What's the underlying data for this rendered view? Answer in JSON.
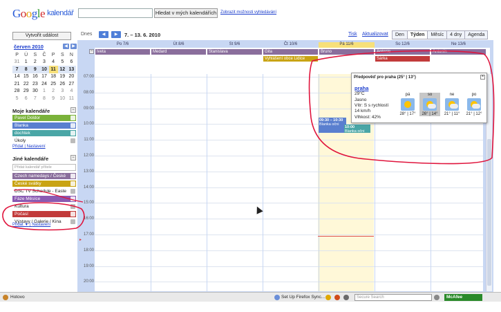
{
  "header": {
    "search_button": "Hledat v mých kalendářích",
    "advanced_link": "Zobrazit možnosti vyhledávání"
  },
  "sidebar": {
    "create_button": "Vytvořit událost",
    "mini_calendar": {
      "title": "červen 2010",
      "weekdays": [
        "P",
        "Ú",
        "S",
        "Č",
        "P",
        "S",
        "N"
      ],
      "weeks": [
        [
          "31",
          "1",
          "2",
          "3",
          "4",
          "5",
          "6"
        ],
        [
          "7",
          "8",
          "9",
          "10",
          "11",
          "12",
          "13"
        ],
        [
          "14",
          "15",
          "16",
          "17",
          "18",
          "19",
          "20"
        ],
        [
          "21",
          "22",
          "23",
          "24",
          "25",
          "26",
          "27"
        ],
        [
          "28",
          "29",
          "30",
          "1",
          "2",
          "3",
          "4"
        ],
        [
          "5",
          "6",
          "7",
          "8",
          "9",
          "10",
          "11"
        ]
      ]
    },
    "my_calendars": {
      "title": "Moje kalendáře",
      "items": [
        {
          "label": "Pavel Doldor",
          "color": "#7ab23a"
        },
        {
          "label": "Blanka",
          "color": "#5a7fcf"
        },
        {
          "label": "dochtek",
          "color": "#4aa6a6"
        },
        {
          "label": "Úkoly",
          "color": ""
        }
      ],
      "add_link": "Přidat",
      "settings_link": "Nastavení"
    },
    "other_calendars": {
      "title": "Jiné kalendáře",
      "add_friend_placeholder": "Přidat kalendář přítele",
      "items": [
        {
          "label": "Czech namedays / České",
          "color": "#8a6e9c"
        },
        {
          "label": "České svátky",
          "color": "#c9a414"
        },
        {
          "label": "DSC TV Schedule - Easte",
          "color": ""
        },
        {
          "label": "Fáze Měsíce",
          "color": "#8a5ab2"
        },
        {
          "label": "Kultura",
          "color": ""
        },
        {
          "label": "Počasí",
          "color": "#c23b3b"
        },
        {
          "label": "Výstavy / Galerie / Kina",
          "color": ""
        }
      ],
      "add_link": "Přidat ▼",
      "settings_link": "Nastavení"
    }
  },
  "toolbar": {
    "today_button": "Dnes",
    "date_range": "7. – 13. 6. 2010",
    "print_link": "Tisk",
    "refresh_link": "Aktualizovat",
    "views": [
      "Den",
      "Týden",
      "Měsíc",
      "4 dny",
      "Agenda"
    ],
    "active_view": "Týden"
  },
  "week": {
    "days": [
      "Po 7/6",
      "Út 8/6",
      "St 9/6",
      "Čt 10/6",
      "Pá 11/6",
      "So 12/6",
      "Ne 13/6"
    ],
    "today_index": 4,
    "allday_events": [
      {
        "label": "Iveta",
        "day": 0,
        "row": 0,
        "color": "#8a6e9c"
      },
      {
        "label": "Medard",
        "day": 1,
        "row": 0,
        "color": "#8a6e9c"
      },
      {
        "label": "Stanislava",
        "day": 2,
        "row": 0,
        "color": "#8a6e9c"
      },
      {
        "label": "Gita",
        "day": 3,
        "row": 0,
        "color": "#8a6e9c"
      },
      {
        "label": "Vyhlášení obce Lidice",
        "day": 3,
        "row": 1,
        "color": "#c9a414"
      },
      {
        "label": "Bruno",
        "day": 4,
        "row": 0,
        "color": "#8a6e9c"
      },
      {
        "label": "Antonie",
        "day": 5,
        "row": 0,
        "color": "#8a6e9c"
      },
      {
        "label": "Antonín",
        "day": 6,
        "row": 0,
        "color": "#8a6e9c"
      },
      {
        "label": "Šárka",
        "day": 5,
        "row": 1,
        "color": "#c23b3b"
      }
    ],
    "hours": [
      "07:00",
      "08:00",
      "09:00",
      "10:00",
      "11:00",
      "12:00",
      "13:00",
      "14:00",
      "15:00",
      "16:00",
      "17:00",
      "18:00",
      "19:00",
      "20:00"
    ],
    "timed_events": [
      {
        "time": "09:30 – 10:30",
        "title": "Blanka očni",
        "color": "#5a7fcf"
      },
      {
        "time": "10:00",
        "title": "Blanka očni",
        "color": "#4aa6a6"
      }
    ]
  },
  "weather_popup": {
    "title": "Předpověď pro praha (25° | 13°)",
    "city": "praha",
    "temperature": "29°C",
    "condition": "Jasno",
    "wind": "Vítr: S s rychlostí",
    "wind_speed": "14 km/h",
    "humidity": "Vlhkost: 42%",
    "forecast": [
      {
        "day": "pá",
        "temps": "28° | 17°",
        "icon": "sun-icon"
      },
      {
        "day": "so",
        "temps": "26° | 14°",
        "icon": "sun-cloud-icon"
      },
      {
        "day": "ne",
        "temps": "21° | 11°",
        "icon": "sun-cloud-icon"
      },
      {
        "day": "po",
        "temps": "21° | 12°",
        "icon": "sun-cloud-icon"
      }
    ],
    "selected_index": 1
  },
  "statusbar": {
    "status": "Hotovo",
    "firefox_sync": "Set Up Firefox Sync...",
    "search_placeholder": "Secure Search",
    "mcafee": "McAfee"
  },
  "colors": {
    "accent": "#4f7fd8",
    "annotation": "#e0143c",
    "today": "#f7e07a"
  }
}
